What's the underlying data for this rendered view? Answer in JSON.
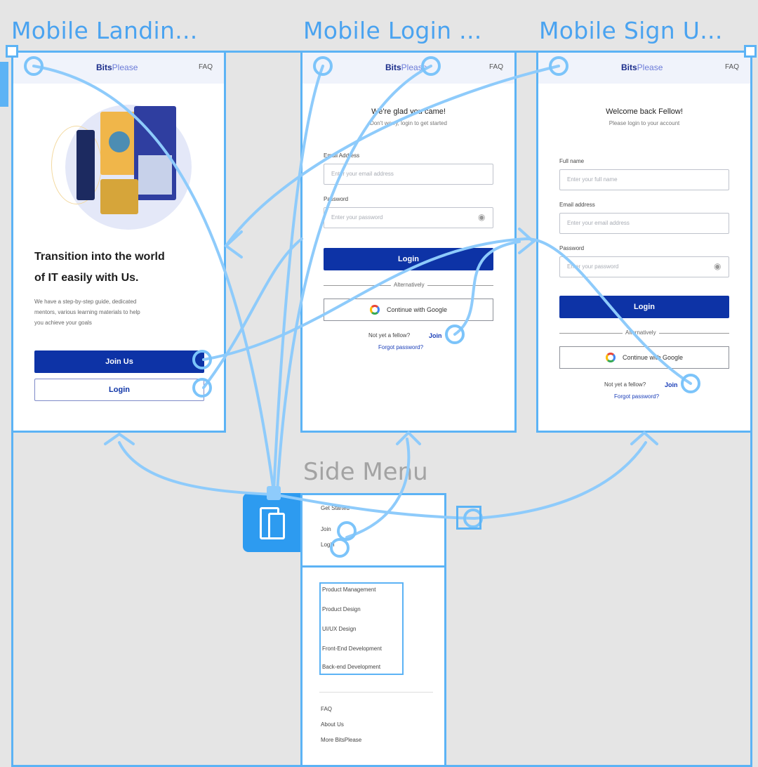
{
  "frames": {
    "landing_title": "Mobile Landin...",
    "login_title": "Mobile Login ...",
    "signup_title": "Mobile Sign U...",
    "side_title": "Side Menu"
  },
  "brand": {
    "main": "Bits",
    "accent": "Please"
  },
  "faq": "FAQ",
  "landing": {
    "heading1": "Transition into the world",
    "heading2": "of IT easily with Us.",
    "body1": "We have a step-by-step guide, dedicated",
    "body2": "mentors, various learning materials to help",
    "body3": "you achieve your goals",
    "join_button": "Join Us",
    "login_button": "Login"
  },
  "login": {
    "heading": "We're glad you came!",
    "subheading": "Don't worry, login to get started",
    "email_label": "Email Address",
    "email_placeholder": "Enter your email address",
    "password_label": "Password",
    "password_placeholder": "Enter your password",
    "login_button": "Login",
    "alt_text": "Alternatively",
    "google_button": "Continue with Google",
    "not_fellow": "Not yet a fellow?",
    "join_link": "Join",
    "forgot": "Forgot password?"
  },
  "signup": {
    "heading": "Welcome back Fellow!",
    "subheading": "Please login to your account",
    "name_label": "Full name",
    "name_placeholder": "Enter your full name",
    "email_label": "Email address",
    "email_placeholder": "Enter your email address",
    "password_label": "Password",
    "password_placeholder": "Enter your password",
    "login_button": "Login",
    "alt_text": "Alternatively",
    "google_button": "Continue with Google",
    "not_fellow": "Not yet a fellow?",
    "join_link": "Join",
    "forgot": "Forgot password?"
  },
  "side_menu": {
    "top_items": [
      "Get Started",
      "Join",
      "Login"
    ],
    "courses": [
      "Product Management",
      "Product Design",
      "UI/UX Design",
      "Front-End Development",
      "Back-end Development"
    ],
    "bottom_items": [
      "FAQ",
      "About Us",
      "More BitsPlease"
    ]
  },
  "colors": {
    "accent": "#5cb3f5",
    "primary": "#0d33a6",
    "canvas": "#e5e5e5"
  }
}
